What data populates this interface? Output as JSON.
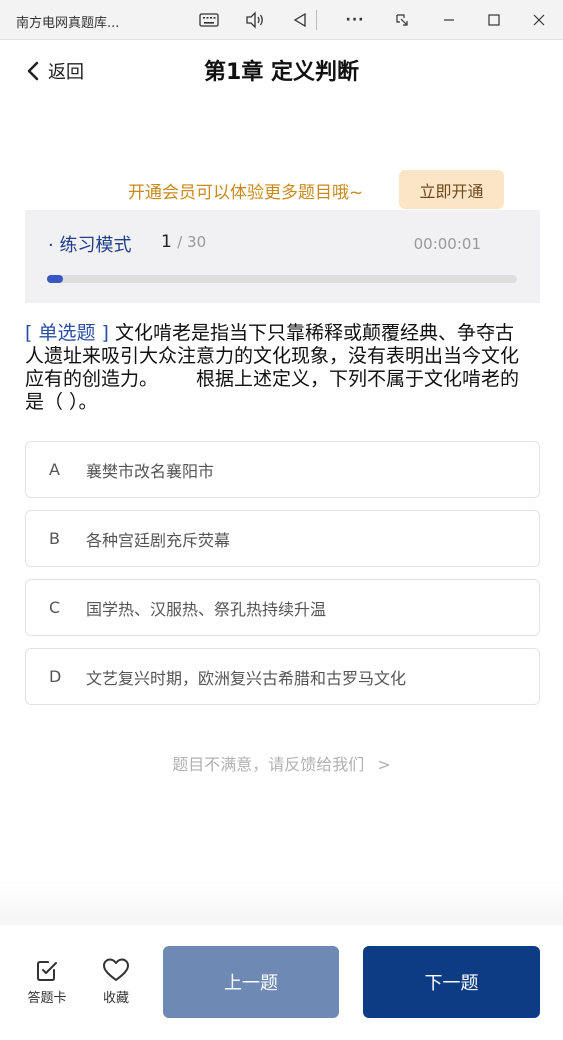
{
  "window": {
    "title": "南方电网真题库...",
    "controls": [
      "keyboard-icon",
      "read-aloud-icon",
      "back-triangle-icon",
      "more-icon",
      "restore-window-icon",
      "minimize-icon",
      "maximize-icon",
      "close-icon"
    ],
    "more_label": "···"
  },
  "header": {
    "back_label": "返回",
    "title": "第1章 定义判断"
  },
  "promo": {
    "text": "开通会员可以体验更多题目哦~",
    "button_label": "立即开通"
  },
  "practice": {
    "mode_label": "· 练习模式",
    "current": "1",
    "total": "/ 30",
    "timer": "00:00:01",
    "progress_fraction": 0.033,
    "accent_color": "#3a57c6"
  },
  "question": {
    "type_label": "[ 单选题 ]",
    "text_part1": " 文化啃老是指当下只靠稀释或颠覆经典、争夺古人遗址来吸引大众注意力的文化现象，没有表明出当今文化应有的创造力。",
    "text_part2": "根据上述定义，下列不属于文化啃老的是（    ）。"
  },
  "options": [
    {
      "letter": "A",
      "text": "襄樊市改名襄阳市"
    },
    {
      "letter": "B",
      "text": "各种宫廷剧充斥荧幕"
    },
    {
      "letter": "C",
      "text": "国学热、汉服热、祭孔热持续升温"
    },
    {
      "letter": "D",
      "text": "文艺复兴时期，欧洲复兴古希腊和古罗马文化"
    }
  ],
  "feedback": {
    "text": "题目不满意，请反馈给我们",
    "arrow": ">"
  },
  "bottom": {
    "answer_card_label": "答题卡",
    "favorite_label": "收藏",
    "prev_label": "上一题",
    "next_label": "下一题",
    "prev_color": "#6e89b3",
    "next_color": "#0d3c85"
  }
}
